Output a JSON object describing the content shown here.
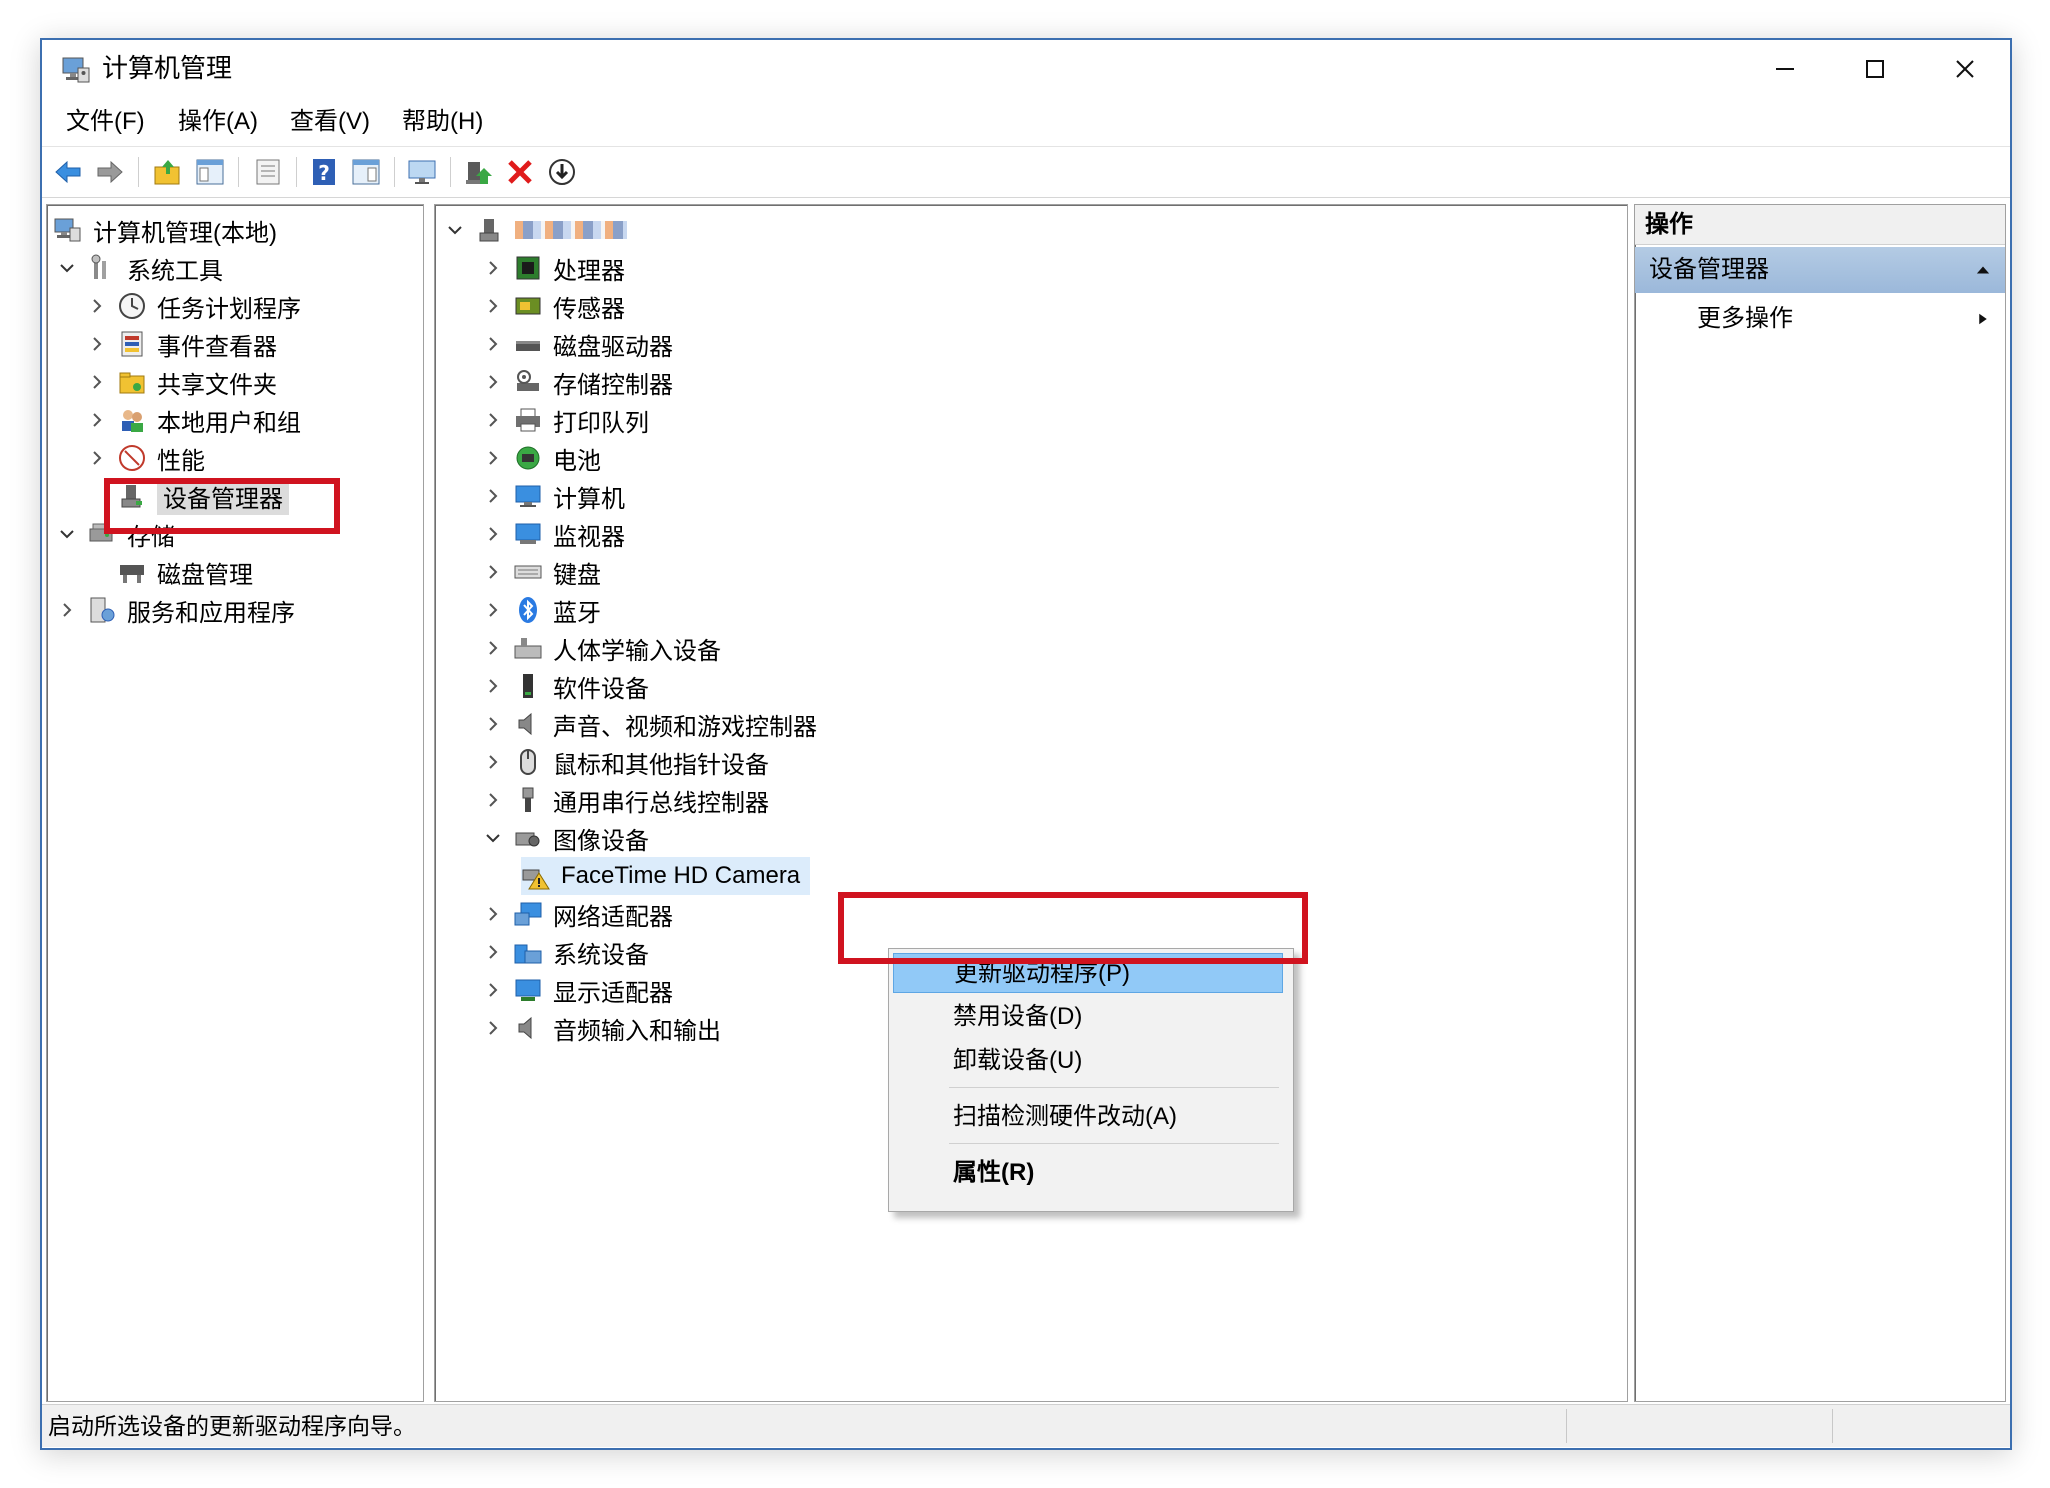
{
  "window": {
    "title": "计算机管理"
  },
  "menu": [
    "文件(F)",
    "操作(A)",
    "查看(V)",
    "帮助(H)"
  ],
  "toolbar": [
    "back-icon",
    "forward-icon",
    "up-folder-icon",
    "show-tree-icon",
    "properties-icon",
    "help-icon",
    "show-action-pane-icon",
    "monitor-icon",
    "update-driver-icon",
    "uninstall-icon",
    "scan-hardware-icon"
  ],
  "left_tree": [
    {
      "label": "计算机管理(本地)"
    },
    {
      "label": "系统工具"
    },
    {
      "label": "任务计划程序"
    },
    {
      "label": "事件查看器"
    },
    {
      "label": "共享文件夹"
    },
    {
      "label": "本地用户和组"
    },
    {
      "label": "性能"
    },
    {
      "label": "设备管理器"
    },
    {
      "label": "存储"
    },
    {
      "label": "磁盘管理"
    },
    {
      "label": "服务和应用程序"
    }
  ],
  "device_tree": [
    {
      "label": "处理器"
    },
    {
      "label": "传感器"
    },
    {
      "label": "磁盘驱动器"
    },
    {
      "label": "存储控制器"
    },
    {
      "label": "打印队列"
    },
    {
      "label": "电池"
    },
    {
      "label": "计算机"
    },
    {
      "label": "监视器"
    },
    {
      "label": "键盘"
    },
    {
      "label": "蓝牙"
    },
    {
      "label": "人体学输入设备"
    },
    {
      "label": "软件设备"
    },
    {
      "label": "声音、视频和游戏控制器"
    },
    {
      "label": "鼠标和其他指针设备"
    },
    {
      "label": "通用串行总线控制器"
    },
    {
      "label": "图像设备"
    },
    {
      "label": "FaceTime HD Camera"
    },
    {
      "label": "网络适配器"
    },
    {
      "label": "系统设备"
    },
    {
      "label": "显示适配器"
    },
    {
      "label": "音频输入和输出"
    }
  ],
  "actions": {
    "header": "操作",
    "section": "设备管理器",
    "item": "更多操作"
  },
  "context_menu": [
    "更新驱动程序(P)",
    "禁用设备(D)",
    "卸载设备(U)",
    "扫描检测硬件改动(A)",
    "属性(R)"
  ],
  "status": "启动所选设备的更新驱动程序向导。",
  "colors": {
    "highlight_box": "#d0131f",
    "menu_highlight": "#91c9f7",
    "action_section": "#9bb8da"
  }
}
